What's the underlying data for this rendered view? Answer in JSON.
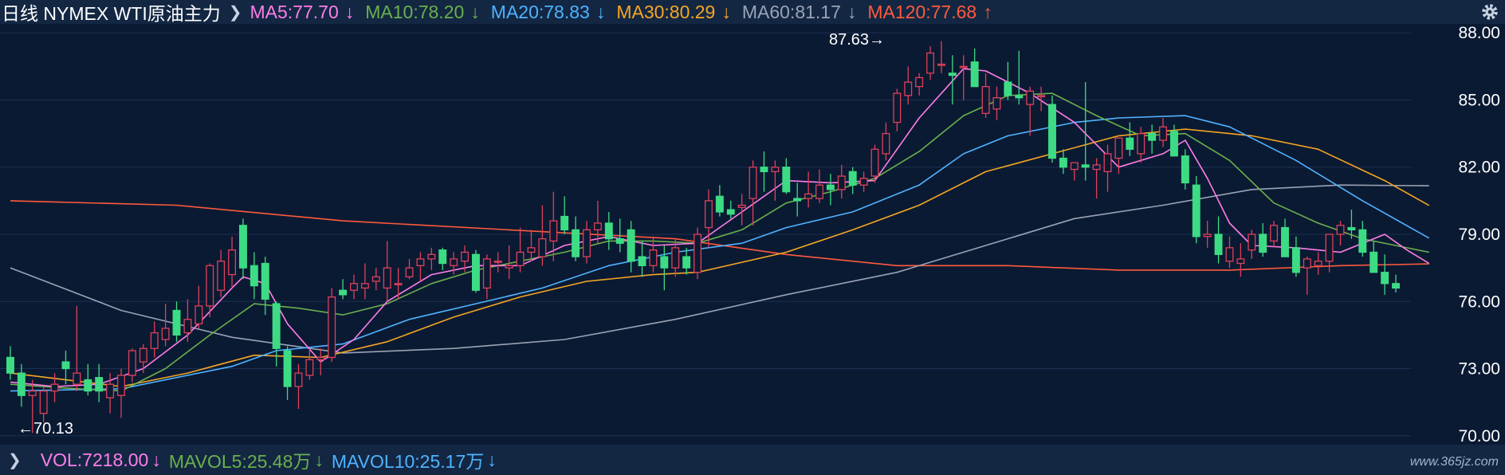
{
  "header": {
    "title": "日线  NYMEX WTI原油主力",
    "ma": [
      {
        "label": "MA5:77.70",
        "arrow": "↓",
        "color": "#ff7ee8"
      },
      {
        "label": "MA10:78.20",
        "arrow": "↓",
        "color": "#6ab04c"
      },
      {
        "label": "MA20:78.83",
        "arrow": "↓",
        "color": "#4fb3ff"
      },
      {
        "label": "MA30:80.29",
        "arrow": "↓",
        "color": "#f5a623"
      },
      {
        "label": "MA60:81.17",
        "arrow": "↓",
        "color": "#9aa3b5"
      },
      {
        "label": "MA120:77.68",
        "arrow": "↑",
        "color": "#ff5a3c"
      }
    ]
  },
  "footer": {
    "vol": {
      "label": "VOL:7218.00",
      "arrow": "↓",
      "color": "#ff7ee8"
    },
    "mavol5": {
      "label": "MAVOL5:25.48万",
      "arrow": "↓",
      "color": "#6ab04c"
    },
    "mavol10": {
      "label": "MAVOL10:25.17万",
      "arrow": "↓",
      "color": "#4fb3ff"
    },
    "watermark": "www.365jz.com"
  },
  "chart_data": {
    "type": "candlestick",
    "ylim": [
      69.6,
      88.4
    ],
    "yticks": [
      "88.00",
      "85.00",
      "82.00",
      "79.00",
      "76.00",
      "73.00",
      "70.00"
    ],
    "annotations": {
      "high": "87.63→",
      "low": "←70.13"
    },
    "colors": {
      "up": "#e0405a",
      "down": "#3ddc84"
    },
    "candles": [
      [
        73.5,
        74.0,
        72.5,
        72.8
      ],
      [
        72.8,
        73.2,
        71.3,
        71.8
      ],
      [
        71.8,
        72.5,
        70.13,
        72.0
      ],
      [
        71.0,
        72.2,
        70.6,
        72.0
      ],
      [
        72.0,
        72.8,
        71.5,
        72.3
      ],
      [
        73.3,
        73.8,
        72.3,
        73.0
      ],
      [
        72.3,
        75.8,
        72.0,
        72.8
      ],
      [
        72.5,
        73.2,
        71.8,
        72.0
      ],
      [
        72.6,
        73.2,
        71.5,
        72.0
      ],
      [
        71.7,
        72.8,
        71.0,
        72.3
      ],
      [
        71.8,
        73.0,
        70.8,
        72.7
      ],
      [
        72.7,
        73.9,
        72.4,
        73.8
      ],
      [
        73.3,
        74.1,
        72.8,
        73.9
      ],
      [
        73.9,
        75.1,
        73.5,
        74.6
      ],
      [
        74.3,
        75.9,
        74.0,
        74.8
      ],
      [
        75.6,
        76.0,
        74.2,
        74.5
      ],
      [
        74.6,
        76.1,
        74.2,
        75.2
      ],
      [
        75.0,
        76.7,
        74.8,
        75.8
      ],
      [
        75.8,
        77.7,
        75.3,
        77.6
      ],
      [
        76.5,
        78.3,
        76.2,
        77.8
      ],
      [
        77.2,
        78.9,
        76.6,
        78.3
      ],
      [
        79.4,
        79.7,
        77.0,
        77.5
      ],
      [
        77.6,
        78.2,
        76.1,
        76.7
      ],
      [
        77.7,
        78.0,
        75.4,
        76.1
      ],
      [
        75.9,
        76.0,
        73.1,
        73.9
      ],
      [
        73.8,
        74.0,
        71.6,
        72.2
      ],
      [
        72.2,
        73.2,
        71.2,
        72.8
      ],
      [
        72.7,
        73.9,
        72.5,
        73.4
      ],
      [
        73.4,
        73.9,
        72.7,
        73.5
      ],
      [
        73.5,
        76.6,
        73.3,
        76.2
      ],
      [
        76.5,
        77.0,
        76.1,
        76.3
      ],
      [
        76.5,
        77.2,
        76.1,
        76.8
      ],
      [
        76.6,
        77.7,
        76.1,
        76.8
      ],
      [
        76.9,
        77.5,
        76.5,
        77.1
      ],
      [
        76.6,
        78.7,
        76.0,
        77.5
      ],
      [
        76.8,
        77.5,
        76.1,
        76.8
      ],
      [
        77.1,
        77.9,
        77.0,
        77.5
      ],
      [
        77.6,
        78.2,
        76.9,
        77.9
      ],
      [
        77.9,
        78.4,
        77.4,
        78.1
      ],
      [
        78.3,
        78.4,
        77.4,
        77.7
      ],
      [
        77.6,
        78.2,
        77.2,
        77.9
      ],
      [
        77.8,
        78.5,
        77.3,
        78.2
      ],
      [
        78.1,
        78.3,
        76.4,
        76.5
      ],
      [
        76.6,
        78.1,
        76.1,
        77.9
      ],
      [
        77.8,
        78.2,
        77.3,
        77.8
      ],
      [
        77.5,
        78.5,
        77.0,
        77.6
      ],
      [
        77.6,
        79.3,
        77.3,
        78.2
      ],
      [
        78.2,
        79.2,
        77.8,
        78.4
      ],
      [
        78.0,
        80.3,
        77.6,
        78.8
      ],
      [
        78.7,
        80.9,
        77.8,
        79.6
      ],
      [
        79.8,
        80.7,
        79.0,
        79.2
      ],
      [
        79.2,
        79.8,
        77.8,
        78.0
      ],
      [
        78.0,
        79.6,
        77.7,
        79.2
      ],
      [
        79.2,
        80.5,
        78.6,
        79.5
      ],
      [
        79.5,
        80.0,
        78.3,
        78.8
      ],
      [
        78.8,
        79.7,
        78.2,
        78.6
      ],
      [
        79.2,
        79.6,
        77.3,
        77.8
      ],
      [
        78.0,
        78.7,
        77.1,
        77.6
      ],
      [
        77.6,
        78.9,
        77.3,
        78.3
      ],
      [
        78.0,
        78.5,
        76.5,
        77.5
      ],
      [
        77.5,
        78.8,
        77.1,
        78.4
      ],
      [
        78.0,
        78.4,
        77.2,
        77.5
      ],
      [
        77.3,
        79.3,
        77.0,
        79.0
      ],
      [
        79.3,
        81.0,
        78.4,
        80.5
      ],
      [
        80.7,
        81.2,
        79.8,
        80.0
      ],
      [
        80.1,
        80.5,
        79.7,
        79.9
      ],
      [
        80.2,
        80.8,
        79.4,
        80.3
      ],
      [
        80.6,
        82.3,
        79.4,
        82.0
      ],
      [
        82.0,
        82.7,
        80.9,
        81.8
      ],
      [
        81.8,
        82.3,
        80.5,
        82.0
      ],
      [
        82.0,
        82.4,
        80.8,
        80.9
      ],
      [
        80.6,
        81.3,
        79.8,
        80.5
      ],
      [
        80.6,
        81.8,
        80.2,
        80.8
      ],
      [
        80.6,
        81.9,
        80.4,
        81.2
      ],
      [
        81.2,
        81.7,
        80.3,
        81.0
      ],
      [
        81.0,
        82.1,
        80.6,
        81.6
      ],
      [
        81.8,
        82.0,
        80.8,
        81.2
      ],
      [
        81.2,
        81.8,
        80.9,
        81.5
      ],
      [
        81.6,
        83.0,
        81.3,
        82.8
      ],
      [
        82.6,
        84.0,
        82.3,
        83.5
      ],
      [
        84.0,
        85.5,
        83.6,
        85.3
      ],
      [
        85.2,
        86.5,
        84.8,
        85.8
      ],
      [
        85.6,
        86.2,
        85.2,
        86.0
      ],
      [
        86.2,
        87.4,
        85.9,
        87.1
      ],
      [
        86.6,
        87.63,
        86.2,
        86.6
      ],
      [
        86.2,
        87.0,
        84.8,
        86.1
      ],
      [
        86.5,
        87.0,
        85.0,
        86.5
      ],
      [
        86.7,
        87.3,
        85.8,
        85.6
      ],
      [
        84.4,
        86.2,
        84.2,
        85.6
      ],
      [
        84.6,
        85.6,
        84.1,
        85.1
      ],
      [
        85.8,
        86.7,
        85.0,
        85.2
      ],
      [
        85.2,
        87.2,
        84.8,
        85.1
      ],
      [
        84.8,
        85.6,
        83.4,
        85.4
      ],
      [
        85.2,
        85.6,
        84.5,
        85.2
      ],
      [
        84.8,
        85.2,
        82.2,
        82.4
      ],
      [
        82.4,
        82.8,
        81.7,
        82.0
      ],
      [
        81.9,
        82.2,
        81.4,
        82.2
      ],
      [
        82.1,
        85.8,
        81.4,
        82.0
      ],
      [
        81.9,
        82.4,
        80.6,
        82.1
      ],
      [
        81.8,
        83.0,
        80.9,
        82.6
      ],
      [
        82.4,
        83.1,
        81.7,
        83.3
      ],
      [
        83.3,
        84.0,
        82.5,
        82.8
      ],
      [
        82.6,
        83.8,
        82.2,
        83.5
      ],
      [
        83.5,
        83.9,
        82.6,
        83.2
      ],
      [
        83.2,
        84.2,
        82.9,
        83.8
      ],
      [
        83.6,
        83.9,
        82.5,
        82.5
      ],
      [
        82.5,
        82.8,
        81.0,
        81.3
      ],
      [
        81.2,
        81.6,
        78.6,
        78.9
      ],
      [
        78.9,
        79.6,
        78.4,
        79.0
      ],
      [
        79.0,
        79.8,
        77.7,
        78.1
      ],
      [
        77.8,
        78.9,
        77.5,
        78.4
      ],
      [
        77.7,
        78.6,
        77.1,
        77.9
      ],
      [
        78.3,
        79.2,
        77.9,
        79.0
      ],
      [
        79.0,
        79.5,
        78.0,
        78.2
      ],
      [
        78.7,
        79.6,
        78.4,
        79.4
      ],
      [
        79.3,
        79.7,
        78.0,
        78.0
      ],
      [
        78.4,
        78.9,
        77.1,
        77.3
      ],
      [
        77.5,
        78.0,
        76.3,
        77.9
      ],
      [
        77.6,
        78.2,
        77.2,
        77.8
      ],
      [
        77.8,
        78.6,
        77.3,
        79.0
      ],
      [
        79.0,
        79.6,
        78.5,
        79.4
      ],
      [
        79.3,
        80.1,
        78.8,
        79.2
      ],
      [
        79.2,
        79.6,
        78.0,
        78.2
      ],
      [
        78.2,
        78.7,
        77.8,
        77.3
      ],
      [
        77.3,
        78.1,
        76.3,
        76.8
      ],
      [
        76.8,
        77.2,
        76.4,
        76.6
      ]
    ],
    "ma_lines": [
      {
        "name": "MA5",
        "color": "#ff7ee8",
        "points": [
          [
            0,
            72.4
          ],
          [
            4,
            72.2
          ],
          [
            8,
            72.3
          ],
          [
            12,
            73.0
          ],
          [
            16,
            74.5
          ],
          [
            20,
            76.6
          ],
          [
            21,
            77.1
          ],
          [
            23,
            76.8
          ],
          [
            25,
            75.0
          ],
          [
            28,
            73.3
          ],
          [
            31,
            74.3
          ],
          [
            34,
            76.0
          ],
          [
            38,
            77.2
          ],
          [
            42,
            77.6
          ],
          [
            46,
            77.6
          ],
          [
            50,
            78.5
          ],
          [
            54,
            78.9
          ],
          [
            58,
            78.5
          ],
          [
            62,
            78.6
          ],
          [
            66,
            80.0
          ],
          [
            70,
            81.4
          ],
          [
            74,
            81.3
          ],
          [
            78,
            81.4
          ],
          [
            82,
            84.2
          ],
          [
            86,
            86.4
          ],
          [
            88,
            86.3
          ],
          [
            92,
            85.3
          ],
          [
            96,
            84.0
          ],
          [
            100,
            82.0
          ],
          [
            104,
            82.6
          ],
          [
            106,
            83.2
          ],
          [
            108,
            81.5
          ],
          [
            110,
            79.5
          ],
          [
            112,
            78.5
          ],
          [
            116,
            78.4
          ],
          [
            120,
            78.2
          ],
          [
            124,
            79.0
          ],
          [
            126,
            78.3
          ],
          [
            128,
            77.7
          ]
        ]
      },
      {
        "name": "MA10",
        "color": "#6ab04c",
        "points": [
          [
            0,
            72.3
          ],
          [
            6,
            72.1
          ],
          [
            10,
            72.0
          ],
          [
            14,
            73.0
          ],
          [
            18,
            74.5
          ],
          [
            22,
            75.9
          ],
          [
            26,
            75.7
          ],
          [
            30,
            75.4
          ],
          [
            34,
            75.9
          ],
          [
            38,
            76.8
          ],
          [
            42,
            77.4
          ],
          [
            46,
            77.8
          ],
          [
            50,
            78.2
          ],
          [
            54,
            78.7
          ],
          [
            58,
            78.7
          ],
          [
            62,
            78.6
          ],
          [
            66,
            79.2
          ],
          [
            70,
            80.4
          ],
          [
            74,
            80.9
          ],
          [
            78,
            81.5
          ],
          [
            82,
            82.7
          ],
          [
            86,
            84.3
          ],
          [
            90,
            85.2
          ],
          [
            94,
            85.3
          ],
          [
            98,
            84.3
          ],
          [
            102,
            83.4
          ],
          [
            106,
            83.5
          ],
          [
            110,
            82.3
          ],
          [
            114,
            80.4
          ],
          [
            118,
            79.5
          ],
          [
            122,
            78.8
          ],
          [
            126,
            78.4
          ],
          [
            128,
            78.2
          ]
        ]
      },
      {
        "name": "MA20",
        "color": "#4fb3ff",
        "points": [
          [
            0,
            72.0
          ],
          [
            10,
            72.1
          ],
          [
            20,
            73.1
          ],
          [
            24,
            73.8
          ],
          [
            30,
            74.1
          ],
          [
            36,
            75.2
          ],
          [
            42,
            75.9
          ],
          [
            48,
            76.6
          ],
          [
            54,
            77.6
          ],
          [
            60,
            78.2
          ],
          [
            66,
            78.6
          ],
          [
            70,
            79.3
          ],
          [
            76,
            80.0
          ],
          [
            82,
            81.2
          ],
          [
            86,
            82.6
          ],
          [
            90,
            83.4
          ],
          [
            96,
            84.0
          ],
          [
            100,
            84.2
          ],
          [
            106,
            84.3
          ],
          [
            110,
            83.8
          ],
          [
            116,
            82.3
          ],
          [
            122,
            80.5
          ],
          [
            128,
            78.83
          ]
        ]
      },
      {
        "name": "MA30",
        "color": "#f5a623",
        "points": [
          [
            0,
            72.8
          ],
          [
            10,
            72.2
          ],
          [
            16,
            72.8
          ],
          [
            22,
            73.6
          ],
          [
            28,
            73.5
          ],
          [
            34,
            74.2
          ],
          [
            40,
            75.3
          ],
          [
            46,
            76.2
          ],
          [
            52,
            76.9
          ],
          [
            58,
            77.2
          ],
          [
            62,
            77.3
          ],
          [
            70,
            78.2
          ],
          [
            76,
            79.2
          ],
          [
            82,
            80.3
          ],
          [
            88,
            81.8
          ],
          [
            94,
            82.6
          ],
          [
            100,
            83.4
          ],
          [
            106,
            83.7
          ],
          [
            112,
            83.4
          ],
          [
            118,
            82.8
          ],
          [
            124,
            81.4
          ],
          [
            128,
            80.29
          ]
        ]
      },
      {
        "name": "MA60",
        "color": "#9aa3b5",
        "points": [
          [
            0,
            77.5
          ],
          [
            10,
            75.6
          ],
          [
            20,
            74.4
          ],
          [
            30,
            73.7
          ],
          [
            40,
            73.9
          ],
          [
            50,
            74.3
          ],
          [
            60,
            75.2
          ],
          [
            70,
            76.3
          ],
          [
            80,
            77.3
          ],
          [
            88,
            78.5
          ],
          [
            96,
            79.7
          ],
          [
            104,
            80.3
          ],
          [
            112,
            81.0
          ],
          [
            120,
            81.2
          ],
          [
            128,
            81.17
          ]
        ]
      },
      {
        "name": "MA120",
        "color": "#ff5a3c",
        "points": [
          [
            0,
            80.5
          ],
          [
            15,
            80.3
          ],
          [
            30,
            79.6
          ],
          [
            45,
            79.2
          ],
          [
            60,
            78.8
          ],
          [
            70,
            78.1
          ],
          [
            80,
            77.6
          ],
          [
            90,
            77.6
          ],
          [
            100,
            77.4
          ],
          [
            110,
            77.4
          ],
          [
            120,
            77.6
          ],
          [
            128,
            77.68
          ]
        ]
      }
    ]
  }
}
